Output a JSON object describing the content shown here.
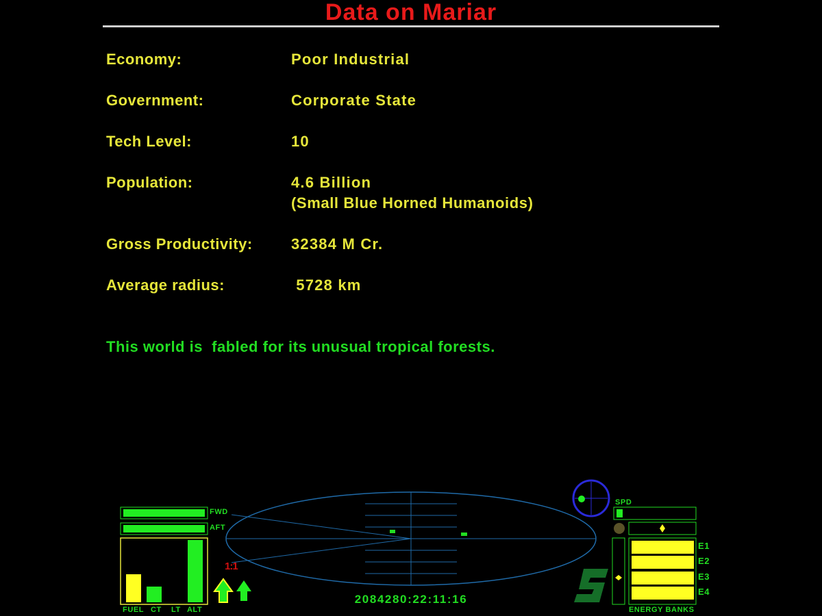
{
  "screen": {
    "title": "Data on Mariar"
  },
  "planet_info": {
    "economy": {
      "label": "Economy:",
      "value": "Poor Industrial"
    },
    "government": {
      "label": "Government:",
      "value": "Corporate State"
    },
    "tech_level": {
      "label": "Tech Level:",
      "value": "10"
    },
    "population": {
      "label": "Population:",
      "value": "4.6 Billion",
      "species": "(Small Blue Horned Humanoids)"
    },
    "gross_productivity": {
      "label": "Gross Productivity:",
      "value": "32384 M Cr."
    },
    "average_radius": {
      "label": "Average radius:",
      "value": " 5728 km"
    },
    "description": "This world is  fabled for its unusual tropical forests."
  },
  "hud": {
    "shields": {
      "fwd_label": "FWD",
      "aft_label": "AFT",
      "fwd_level": 1.0,
      "aft_level": 1.0
    },
    "gauges": {
      "labels": [
        "FUEL",
        "CT",
        "LT",
        "ALT"
      ],
      "levels": [
        0.45,
        0.25,
        0.0,
        1.0
      ]
    },
    "scanner_zoom": "1:1",
    "clock": "2084280:22:11:16",
    "speed": {
      "label": "SPD",
      "level": 0.08
    },
    "energy_banks": {
      "label": "ENERGY BANKS",
      "banks": [
        "E1",
        "E2",
        "E3",
        "E4"
      ],
      "levels": [
        1.0,
        1.0,
        1.0,
        1.0
      ]
    },
    "colors": {
      "hud_green": "#22dd22",
      "gauge_yellow": "#ffff22",
      "title_red": "#e81a1a",
      "info_yellow": "#e6e63a",
      "scanner_blue": "#1f6aa8",
      "compass_blue": "#2a2ad8"
    },
    "icons": [
      "compass-icon",
      "status-condition-icon",
      "alert-light-icon",
      "missile-icon",
      "pitch-roll-arrow-icon"
    ]
  }
}
